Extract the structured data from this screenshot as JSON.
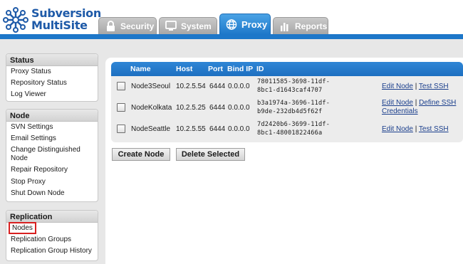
{
  "brand": {
    "line1": "Subversion",
    "line2": "MultiSite",
    "icon": "network-nodes-logo-icon"
  },
  "tabs": [
    {
      "label": "Security",
      "icon": "lock-icon"
    },
    {
      "label": "System",
      "icon": "monitor-icon"
    },
    {
      "label": "Proxy",
      "icon": "globe-icon",
      "active": true
    },
    {
      "label": "Reports",
      "icon": "bar-chart-icon"
    }
  ],
  "sidebar": {
    "status": {
      "title": "Status",
      "items": [
        "Proxy Status",
        "Repository Status",
        "Log Viewer"
      ]
    },
    "node": {
      "title": "Node",
      "items": [
        "SVN Settings",
        "Email Settings",
        "Change Distinguished Node",
        "Repair Repository",
        "Stop Proxy",
        "Shut Down Node"
      ]
    },
    "replication": {
      "title": "Replication",
      "items": [
        "Nodes",
        "Replication Groups",
        "Replication Group History"
      ],
      "selected": "Nodes"
    }
  },
  "table": {
    "headers": {
      "name": "Name",
      "host": "Host",
      "port": "Port",
      "bind_ip": "Bind IP",
      "id": "ID"
    },
    "rows": [
      {
        "name": "Node3Seoul",
        "host": "10.2.5.54",
        "port": "6444",
        "bind_ip": "0.0.0.0",
        "id_line1": "78011585-3698-11df-",
        "id_line2": "8bc1-d1643caf4707",
        "action1": "Edit Node",
        "action2": "Test SSH",
        "action2_line2": ""
      },
      {
        "name": "NodeKolkata",
        "host": "10.2.5.25",
        "port": "6444",
        "bind_ip": "0.0.0.0",
        "id_line1": "b3a1974a-3696-11df-",
        "id_line2": "b9de-232db4d5f62f",
        "action1": "Edit Node",
        "action2": "Define SSH",
        "action2_line2": "Credentials"
      },
      {
        "name": "NodeSeattle",
        "host": "10.2.5.55",
        "port": "6444",
        "bind_ip": "0.0.0.0",
        "id_line1": "7d2420b6-3699-11df-",
        "id_line2": "8bc1-48001822466a",
        "action1": "Edit Node",
        "action2": "Test SSH",
        "action2_line2": ""
      }
    ],
    "separator": "|"
  },
  "buttons": {
    "create": "Create Node",
    "delete": "Delete Selected"
  },
  "colors": {
    "accent": "#1d77c9",
    "highlight": "#d82020",
    "brand": "#1e5aa8"
  }
}
